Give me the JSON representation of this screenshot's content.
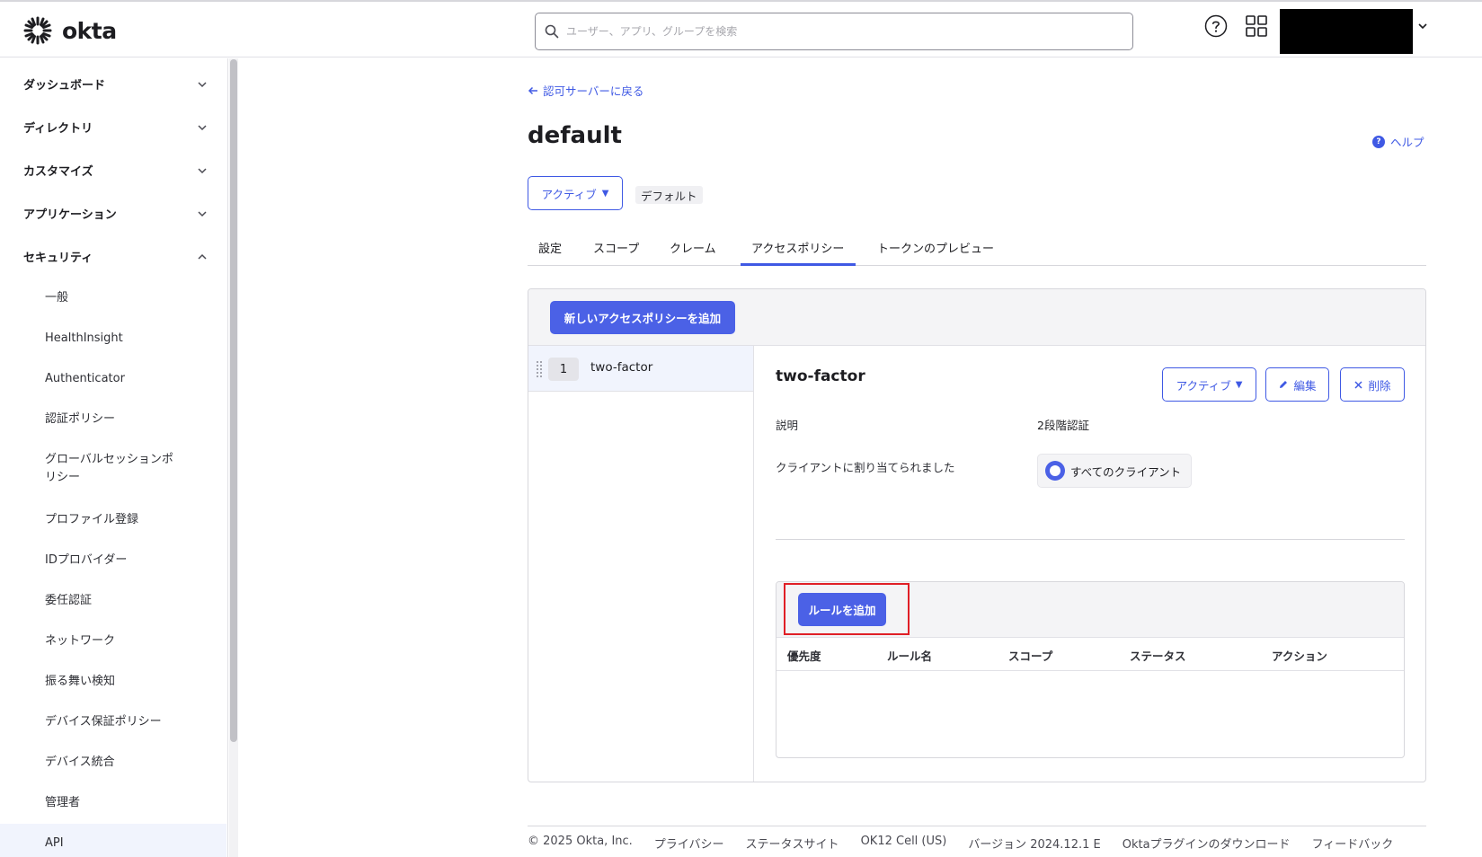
{
  "header": {
    "logo_text": "okta",
    "search_placeholder": "ユーザー、アプリ、グループを検索"
  },
  "sidebar": {
    "sections": [
      {
        "label": "ダッシュボード"
      },
      {
        "label": "ディレクトリ"
      },
      {
        "label": "カスタマイズ"
      },
      {
        "label": "アプリケーション"
      },
      {
        "label": "セキュリティ"
      }
    ],
    "security_items": [
      {
        "label": "一般"
      },
      {
        "label": "HealthInsight"
      },
      {
        "label": "Authenticator"
      },
      {
        "label": "認証ポリシー"
      },
      {
        "label": "グローバルセッションポリシー"
      },
      {
        "label": "プロファイル登録"
      },
      {
        "label": "IDプロバイダー"
      },
      {
        "label": "委任認証"
      },
      {
        "label": "ネットワーク"
      },
      {
        "label": "振る舞い検知"
      },
      {
        "label": "デバイス保証ポリシー"
      },
      {
        "label": "デバイス統合"
      },
      {
        "label": "管理者"
      },
      {
        "label": "API"
      }
    ]
  },
  "main": {
    "back_link": "認可サーバーに戻る",
    "title": "default",
    "help_label": "ヘルプ",
    "status_label": "アクティブ",
    "default_badge": "デフォルト",
    "tabs": [
      {
        "label": "設定"
      },
      {
        "label": "スコープ"
      },
      {
        "label": "クレーム"
      },
      {
        "label": "アクセスポリシー"
      },
      {
        "label": "トークンのプレビュー"
      }
    ],
    "active_tab": "アクセスポリシー"
  },
  "policies": {
    "add_button": "新しいアクセスポリシーを追加",
    "list": [
      {
        "priority": "1",
        "name": "two-factor"
      }
    ],
    "detail": {
      "title": "two-factor",
      "status_button": "アクティブ",
      "edit_button": "編集",
      "delete_button": "削除",
      "description_label": "説明",
      "description_value": "2段階認証",
      "clients_label": "クライアントに割り当てられました",
      "clients_value": "すべてのクライアント"
    },
    "rules": {
      "add_rule_button": "ルールを追加",
      "columns": [
        "優先度",
        "ルール名",
        "スコープ",
        "ステータス",
        "アクション"
      ]
    }
  },
  "footer": {
    "links": [
      "© 2025 Okta, Inc.",
      "プライバシー",
      "ステータスサイト",
      "OK12 Cell (US)",
      "バージョン 2024.12.1 E",
      "Oktaプラグインのダウンロード",
      "フィードバック"
    ]
  },
  "colors": {
    "accent": "#4b61e6",
    "link": "#3f59e4",
    "highlight": "#e01f26"
  }
}
